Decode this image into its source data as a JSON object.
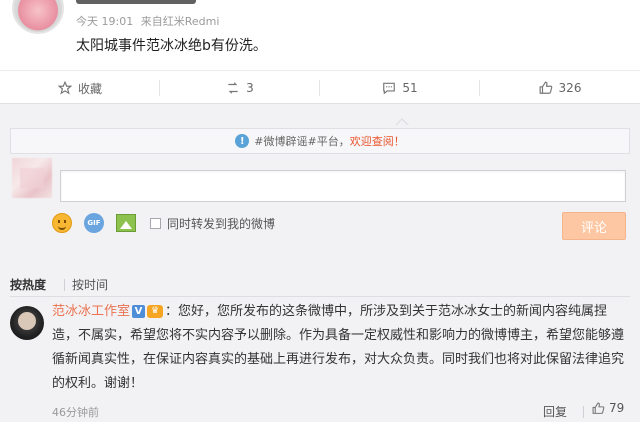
{
  "post": {
    "meta": {
      "date": "今天 19:01",
      "source_prefix": "来自",
      "source": "红米Redmi"
    },
    "content": "太阳城事件范冰冰绝b有份洗。"
  },
  "actions": [
    {
      "icon": "star-icon",
      "label": "收藏"
    },
    {
      "icon": "forward-icon",
      "label": "3"
    },
    {
      "icon": "comment-icon",
      "label": "51"
    },
    {
      "icon": "thumbs-up-icon",
      "label": "326"
    }
  ],
  "notice": {
    "text": "#微博辟谣#平台，",
    "link": "欢迎查阅！"
  },
  "composer": {
    "input_value": "",
    "forward_label": "同时转发到我的微博",
    "submit_label": "评论"
  },
  "sort": {
    "active": "按热度",
    "other": "按时间"
  },
  "comment": {
    "author": "范冰冰工作室",
    "verified_badge": "V",
    "text": "：您好，您所发布的这条微博中，所涉及到关于范冰冰女士的新闻内容纯属捏造，不属实，希望您将不实内容予以删除。作为具备一定权威性和影响力的微博博主，希望您能够遵循新闻真实性，在保证内容真实的基础上再进行发布，对大众负责。同时我们也将对此保留法律追究的权利。谢谢！",
    "time": "46分钟前",
    "reply_label": "回复",
    "likes": "79"
  },
  "colors": {
    "accent": "#eb7350",
    "link": "#e8562b",
    "submit_bg": "#fdc7a3"
  }
}
